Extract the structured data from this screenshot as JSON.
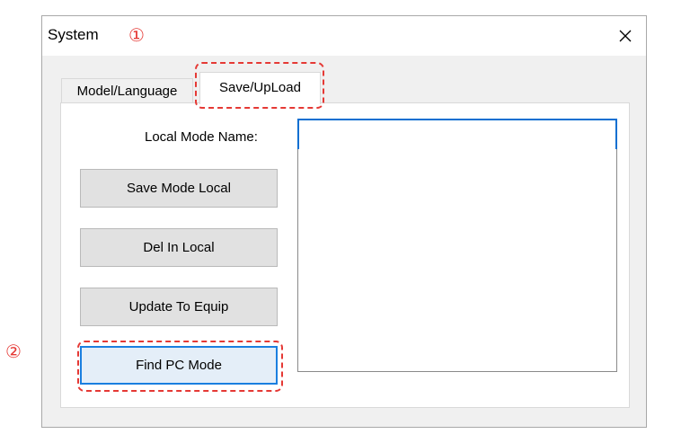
{
  "window": {
    "title": "System",
    "close_icon": "close-icon"
  },
  "tabs": [
    {
      "label": "Model/Language",
      "selected": false
    },
    {
      "label": "Save/UpLoad",
      "selected": true
    }
  ],
  "form": {
    "local_mode_name_label": "Local Mode Name:",
    "local_mode_name_value": "",
    "mode_list_items": []
  },
  "buttons": {
    "save_mode_local": "Save Mode Local",
    "del_in_local": "Del In Local",
    "update_to_equip": "Update To Equip",
    "find_pc_mode": "Find PC Mode"
  },
  "annotations": {
    "marker_1": "①",
    "marker_2": "②"
  },
  "colors": {
    "callout": "#e53935",
    "focus": "#0a6fd1",
    "dialog_background": "#f0f0f0"
  }
}
